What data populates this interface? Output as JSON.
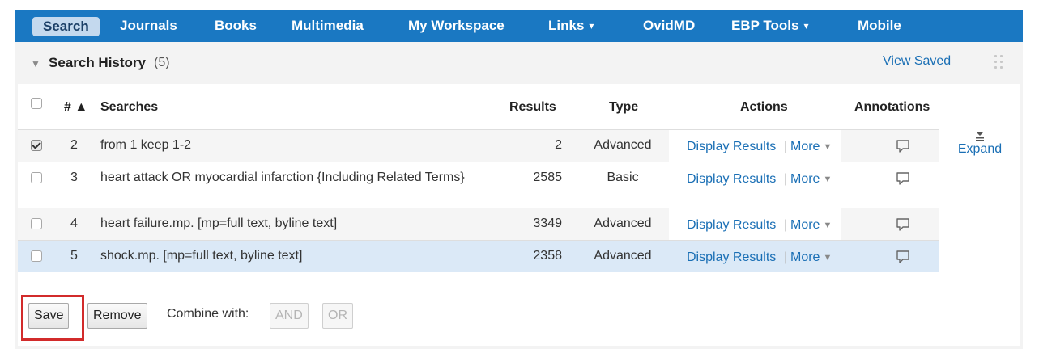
{
  "nav": {
    "items": [
      {
        "label": "Search",
        "active": true
      },
      {
        "label": "Journals"
      },
      {
        "label": "Books"
      },
      {
        "label": "Multimedia"
      },
      {
        "label": "My Workspace"
      },
      {
        "label": "Links",
        "dropdown": true
      },
      {
        "label": "OvidMD"
      },
      {
        "label": "EBP Tools",
        "dropdown": true
      },
      {
        "label": "Mobile"
      }
    ],
    "caret": "▾"
  },
  "history": {
    "collapse_icon": "▼",
    "title": "Search History",
    "count": "(5)",
    "view_saved": "View Saved"
  },
  "table": {
    "headers": {
      "num": "# ▲",
      "searches": "Searches",
      "results": "Results",
      "type": "Type",
      "actions": "Actions",
      "annotations": "Annotations"
    },
    "rows": [
      {
        "checked": true,
        "num": "2",
        "query": "from 1 keep 1-2",
        "results": "2",
        "type": "Advanced",
        "display": "Display Results",
        "sep": "|",
        "more": "More"
      },
      {
        "checked": false,
        "num": "3",
        "query": "heart attack OR myocardial infarction {Including Related Terms}",
        "results": "2585",
        "type": "Basic",
        "display": "Display Results",
        "sep": "|",
        "more": "More"
      },
      {
        "checked": false,
        "num": "4",
        "query": "heart failure.mp. [mp=full text, byline text]",
        "results": "3349",
        "type": "Advanced",
        "display": "Display Results",
        "sep": "|",
        "more": "More"
      },
      {
        "checked": false,
        "num": "5",
        "query": "shock.mp. [mp=full text, byline text]",
        "results": "2358",
        "type": "Advanced",
        "display": "Display Results",
        "sep": "|",
        "more": "More"
      }
    ],
    "more_caret": "▼",
    "expand_label": "Expand"
  },
  "controls": {
    "save_label": "Save",
    "remove_label": "Remove",
    "combine_label": "Combine with:",
    "and_label": "AND",
    "or_label": "OR"
  },
  "colors": {
    "nav_bg": "#1a78c2",
    "link": "#1a6fb5",
    "selected_row": "#dbe9f7",
    "highlight": "#d22b2b"
  },
  "icons": {
    "annotation": "speech-bubble-icon",
    "expand": "expand-icon",
    "collapse": "triangle-down-icon",
    "drag": "drag-handle-icon"
  }
}
